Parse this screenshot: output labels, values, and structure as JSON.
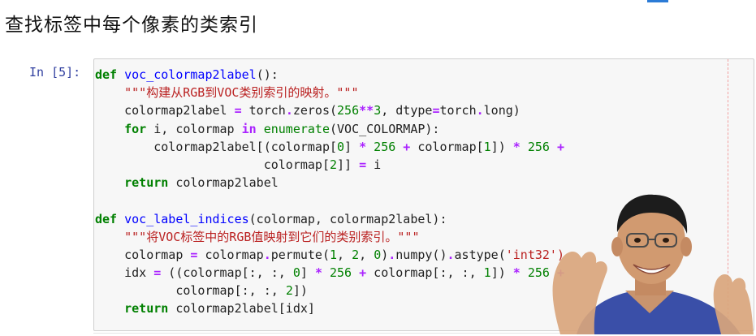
{
  "page": {
    "title": "查找标签中每个像素的类索引"
  },
  "cell": {
    "prompt": "In [5]:",
    "lines": [
      [
        {
          "t": "def",
          "c": "kw"
        },
        {
          "t": " "
        },
        {
          "t": "voc_colormap2label",
          "c": "fn"
        },
        {
          "t": "():"
        }
      ],
      [
        {
          "t": "    "
        },
        {
          "t": "\"\"\"构建从RGB到VOC类别索引的映射。\"\"\"",
          "c": "str"
        }
      ],
      [
        {
          "t": "    colormap2label "
        },
        {
          "t": "=",
          "c": "op"
        },
        {
          "t": " torch"
        },
        {
          "t": ".",
          "c": "op"
        },
        {
          "t": "zeros("
        },
        {
          "t": "256",
          "c": "num"
        },
        {
          "t": "**",
          "c": "op"
        },
        {
          "t": "3",
          "c": "num"
        },
        {
          "t": ", dtype"
        },
        {
          "t": "=",
          "c": "op"
        },
        {
          "t": "torch"
        },
        {
          "t": ".",
          "c": "op"
        },
        {
          "t": "long)"
        }
      ],
      [
        {
          "t": "    "
        },
        {
          "t": "for",
          "c": "kw"
        },
        {
          "t": " i, colormap "
        },
        {
          "t": "in",
          "c": "op"
        },
        {
          "t": " "
        },
        {
          "t": "enumerate",
          "c": "bi"
        },
        {
          "t": "(VOC_COLORMAP):"
        }
      ],
      [
        {
          "t": "        colormap2label[(colormap["
        },
        {
          "t": "0",
          "c": "num"
        },
        {
          "t": "] "
        },
        {
          "t": "*",
          "c": "op"
        },
        {
          "t": " "
        },
        {
          "t": "256",
          "c": "num"
        },
        {
          "t": " "
        },
        {
          "t": "+",
          "c": "op"
        },
        {
          "t": " colormap["
        },
        {
          "t": "1",
          "c": "num"
        },
        {
          "t": "]) "
        },
        {
          "t": "*",
          "c": "op"
        },
        {
          "t": " "
        },
        {
          "t": "256",
          "c": "num"
        },
        {
          "t": " "
        },
        {
          "t": "+",
          "c": "op"
        }
      ],
      [
        {
          "t": "                       colormap["
        },
        {
          "t": "2",
          "c": "num"
        },
        {
          "t": "]] "
        },
        {
          "t": "=",
          "c": "op"
        },
        {
          "t": " i"
        }
      ],
      [
        {
          "t": "    "
        },
        {
          "t": "return",
          "c": "kw"
        },
        {
          "t": " colormap2label"
        }
      ],
      [
        {
          "t": ""
        }
      ],
      [
        {
          "t": "def",
          "c": "kw"
        },
        {
          "t": " "
        },
        {
          "t": "voc_label_indices",
          "c": "fn"
        },
        {
          "t": "(colormap, colormap2label):"
        }
      ],
      [
        {
          "t": "    "
        },
        {
          "t": "\"\"\"将VOC标签中的RGB值映射到它们的类别索引。\"\"\"",
          "c": "str"
        }
      ],
      [
        {
          "t": "    colormap "
        },
        {
          "t": "=",
          "c": "op"
        },
        {
          "t": " colormap"
        },
        {
          "t": ".",
          "c": "op"
        },
        {
          "t": "permute("
        },
        {
          "t": "1",
          "c": "num"
        },
        {
          "t": ", "
        },
        {
          "t": "2",
          "c": "num"
        },
        {
          "t": ", "
        },
        {
          "t": "0",
          "c": "num"
        },
        {
          "t": ")"
        },
        {
          "t": ".",
          "c": "op"
        },
        {
          "t": "numpy()"
        },
        {
          "t": ".",
          "c": "op"
        },
        {
          "t": "astype("
        },
        {
          "t": "'int32')",
          "c": "str"
        }
      ],
      [
        {
          "t": "    idx "
        },
        {
          "t": "=",
          "c": "op"
        },
        {
          "t": " ((colormap[:, :, "
        },
        {
          "t": "0",
          "c": "num"
        },
        {
          "t": "] "
        },
        {
          "t": "*",
          "c": "op"
        },
        {
          "t": " "
        },
        {
          "t": "256",
          "c": "num"
        },
        {
          "t": " "
        },
        {
          "t": "+",
          "c": "op"
        },
        {
          "t": " colormap[:, :, "
        },
        {
          "t": "1",
          "c": "num"
        },
        {
          "t": "]) "
        },
        {
          "t": "*",
          "c": "op"
        },
        {
          "t": " "
        },
        {
          "t": "256",
          "c": "num"
        },
        {
          "t": " "
        },
        {
          "t": "+",
          "c": "op"
        }
      ],
      [
        {
          "t": "           colormap[:, :, "
        },
        {
          "t": "2",
          "c": "num"
        },
        {
          "t": "])"
        }
      ],
      [
        {
          "t": "    "
        },
        {
          "t": "return",
          "c": "kw"
        },
        {
          "t": " colormap2label[idx]"
        }
      ]
    ]
  },
  "colors": {
    "prompt": "#303f9f",
    "keyword": "#008000",
    "function": "#0000ff",
    "string": "#ba2121",
    "operator": "#aa22ff",
    "cell_background": "#f7f7f7"
  }
}
